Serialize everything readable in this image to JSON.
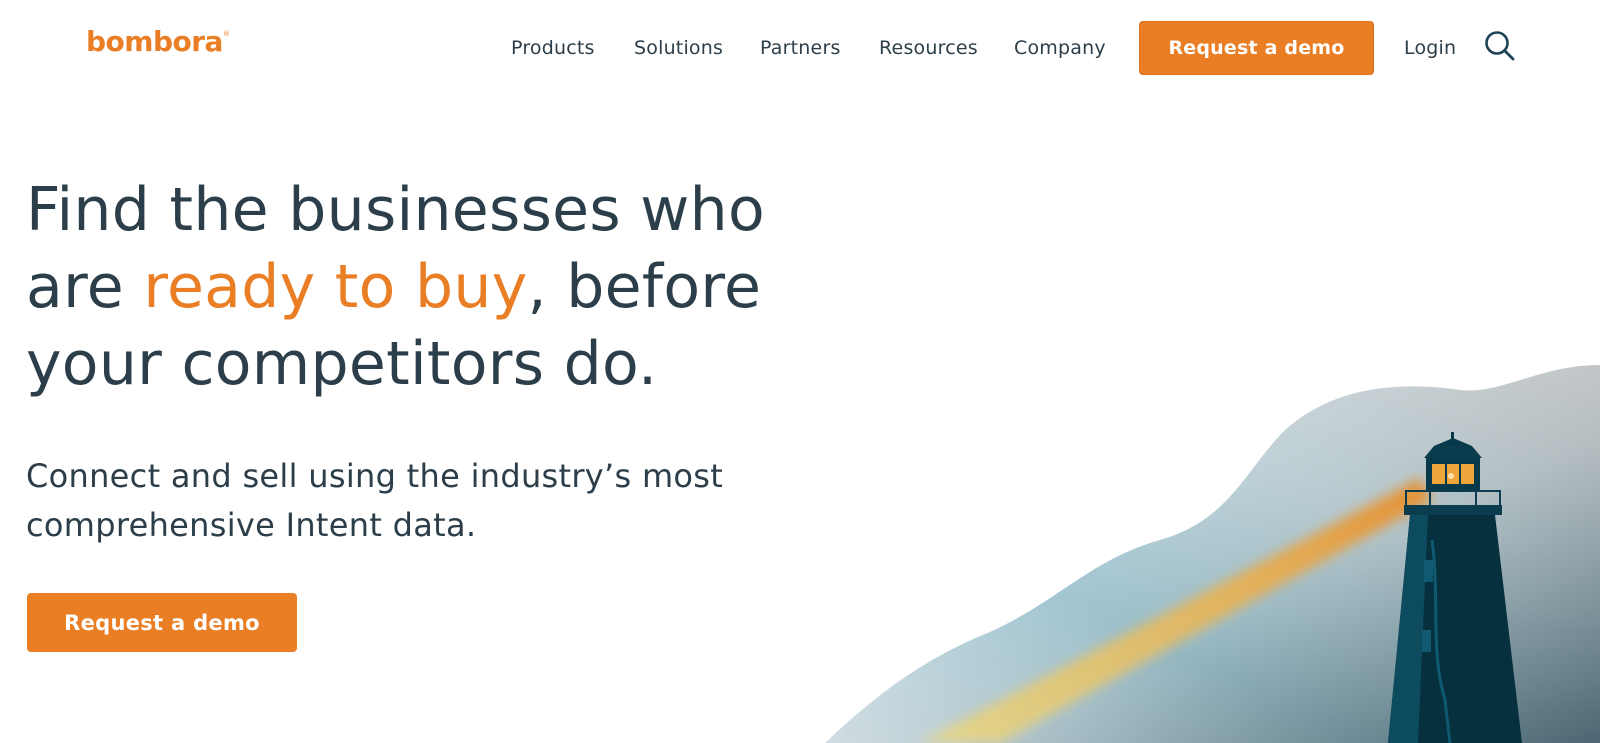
{
  "brand": {
    "logo_text": "bombora",
    "logo_mark": "®",
    "accent_color": "#e97e24",
    "text_color": "#2c3e4a"
  },
  "nav": {
    "items": [
      {
        "label": "Products"
      },
      {
        "label": "Solutions"
      },
      {
        "label": "Partners"
      },
      {
        "label": "Resources"
      },
      {
        "label": "Company"
      }
    ],
    "cta_label": "Request a demo",
    "login_label": "Login",
    "search_icon": "search-icon"
  },
  "hero": {
    "title_part1": "Find the businesses who are ",
    "title_accent": "ready to buy",
    "title_part2": ", before your competitors do.",
    "subtitle": "Connect and sell using the industry’s most comprehensive Intent data.",
    "cta_label": "Request a demo",
    "illustration": "lighthouse-illustration"
  }
}
